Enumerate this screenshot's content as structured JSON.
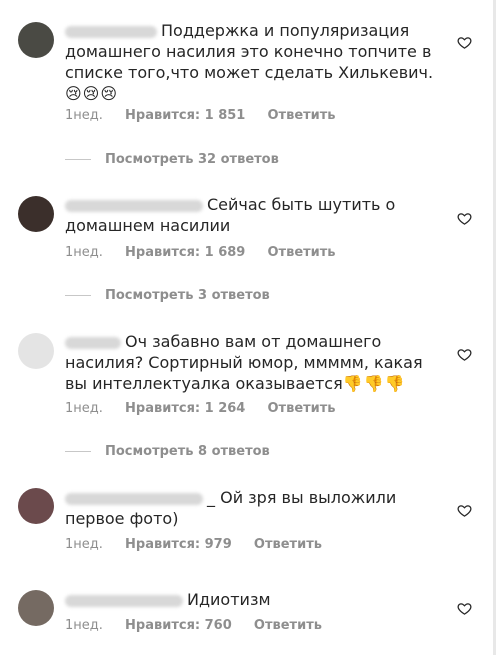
{
  "comments": [
    {
      "text": "Поддержка и популяризация домашнего насилия это конечно топчите в списке того,что может сделать Хилькевич.",
      "emoji": "😢😢😢",
      "time": "1нед.",
      "likes": "Нравится: 1 851",
      "reply": "Ответить",
      "view_replies": "Посмотреть 32 ответов",
      "avatar_color": "#4a4a44",
      "heart_icon": "heart-outline"
    },
    {
      "text": "Сейчас быть шутить о домашнем насилии",
      "time": "1нед.",
      "likes": "Нравится: 1 689",
      "reply": "Ответить",
      "view_replies": "Посмотреть 3 ответов",
      "avatar_color": "#3b2f2b",
      "heart_icon": "heart-outline"
    },
    {
      "text": "Оч забавно вам от домашнего насилия? Сортирный юмор, ммммм, какая вы интеллектуалка оказывается",
      "emoji": "👎👎👎",
      "time": "1нед.",
      "likes": "Нравится: 1 264",
      "reply": "Ответить",
      "view_replies": "Посмотреть 8 ответов",
      "avatar_color": "#e4e4e4",
      "heart_icon": "heart-outline"
    },
    {
      "text": "Ой зря вы выложили первое фото)",
      "username_suffix": "_",
      "time": "1нед.",
      "likes": "Нравится: 979",
      "reply": "Ответить",
      "avatar_color": "#6b4a4c",
      "heart_icon": "heart-outline"
    },
    {
      "text": "Идиотизм",
      "time": "1нед.",
      "likes": "Нравится: 760",
      "reply": "Ответить",
      "avatar_color": "#756a62",
      "heart_icon": "heart-outline"
    }
  ]
}
